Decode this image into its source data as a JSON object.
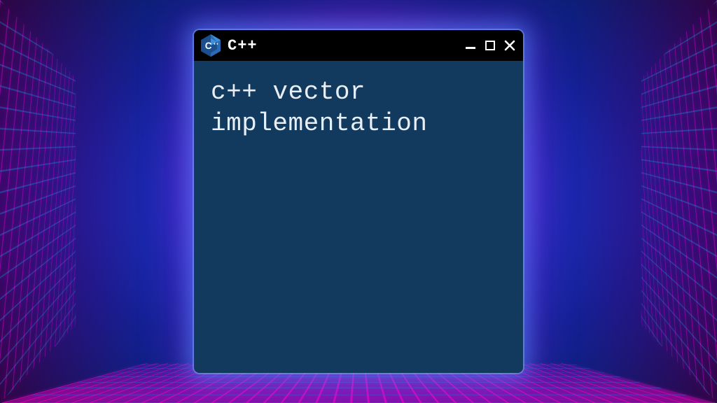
{
  "window": {
    "title": "C++",
    "content": "c++ vector implementation"
  },
  "colors": {
    "console_bg": "#123a5e",
    "titlebar_bg": "#000000",
    "text": "#e8eef6"
  }
}
